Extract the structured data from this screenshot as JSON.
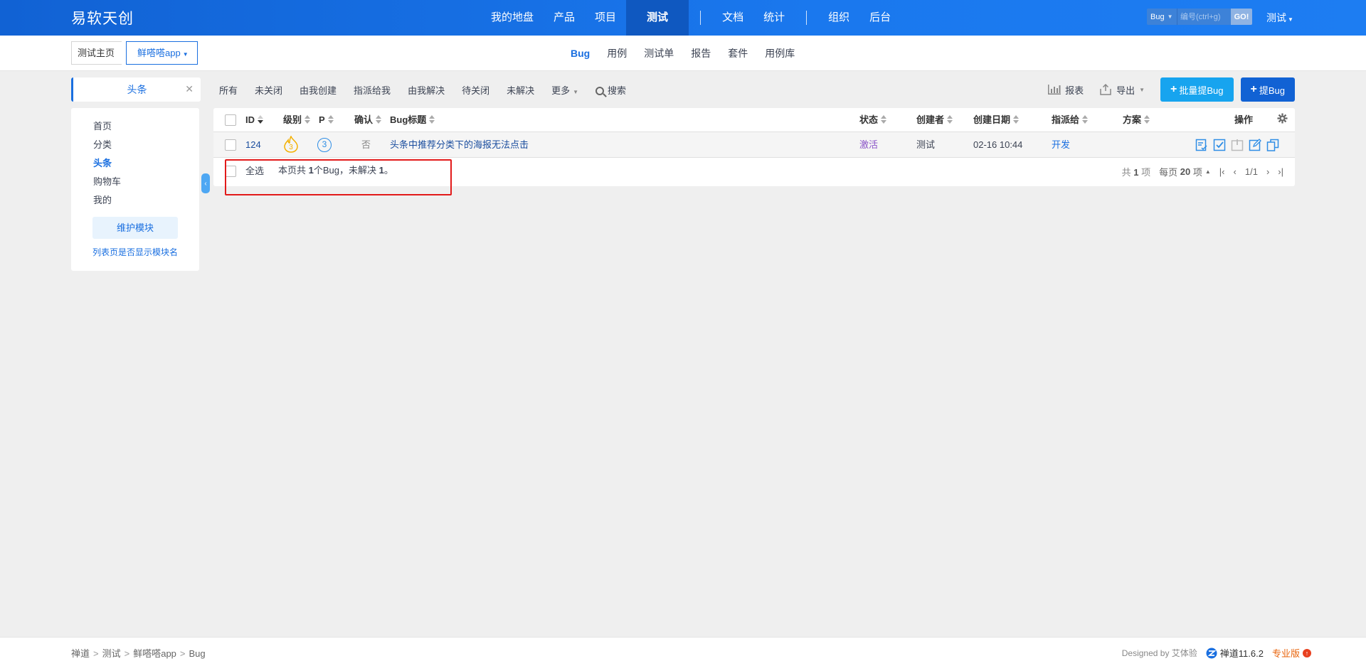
{
  "header": {
    "brand": "易软天创",
    "nav": [
      {
        "label": "我的地盘",
        "active": false
      },
      {
        "label": "产品",
        "active": false
      },
      {
        "label": "项目",
        "active": false
      },
      {
        "label": "测试",
        "active": true
      },
      {
        "label": "文档",
        "active": false
      },
      {
        "label": "统计",
        "active": false
      },
      {
        "label": "组织",
        "active": false
      },
      {
        "label": "后台",
        "active": false
      }
    ],
    "search": {
      "type": "Bug",
      "placeholder": "编号(ctrl+g)",
      "go": "GO!"
    },
    "user": "测试"
  },
  "subheader": {
    "home_crumb": "测试主页",
    "product_crumb": "鲜嗒嗒app",
    "tabs": [
      {
        "label": "Bug",
        "active": true
      },
      {
        "label": "用例",
        "active": false
      },
      {
        "label": "测试单",
        "active": false
      },
      {
        "label": "报告",
        "active": false
      },
      {
        "label": "套件",
        "active": false
      },
      {
        "label": "用例库",
        "active": false
      }
    ]
  },
  "featurebar": {
    "module_tab": "头条",
    "filters": [
      "所有",
      "未关闭",
      "由我创建",
      "指派给我",
      "由我解决",
      "待关闭",
      "未解决",
      "更多",
      "搜索"
    ],
    "report": "报表",
    "export": "导出",
    "batch_create": "批量提Bug",
    "create": "提Bug"
  },
  "sidebar": {
    "items": [
      {
        "label": "首页",
        "active": false
      },
      {
        "label": "分类",
        "active": false
      },
      {
        "label": "头条",
        "active": true
      },
      {
        "label": "购物车",
        "active": false
      },
      {
        "label": "我的",
        "active": false
      }
    ],
    "maintain_button": "维护模块",
    "show_module_link": "列表页是否显示模块名"
  },
  "table": {
    "headers": {
      "id": "ID",
      "severity": "级别",
      "pri": "P",
      "confirmed": "确认",
      "title": "Bug标题",
      "status": "状态",
      "creator": "创建者",
      "created_date": "创建日期",
      "assigned_to": "指派给",
      "resolution": "方案",
      "actions": "操作"
    },
    "rows": [
      {
        "id": "124",
        "severity": "3",
        "pri": "3",
        "confirmed": "否",
        "title": "头条中推荐分类下的海报无法点击",
        "status": "激活",
        "creator": "测试",
        "created_date": "02-16 10:44",
        "assigned_to": "开发",
        "resolution": ""
      }
    ],
    "footer": {
      "select_all": "全选",
      "summary_prefix": "本页共",
      "summary_count": "1",
      "summary_mid": "个Bug，未解决",
      "summary_unresolved": "1",
      "summary_end": "。",
      "total_prefix": "共",
      "total": "1",
      "total_suffix": "项",
      "per_page_prefix": "每页",
      "per_page": "20",
      "per_page_suffix": "项",
      "page": "1/1"
    }
  },
  "footer": {
    "crumbs": [
      "禅道",
      "测试",
      "鲜嗒嗒app",
      "Bug"
    ],
    "designed_by": "Designed by 艾体验",
    "version": "禅道11.6.2",
    "edition": "专业版"
  },
  "colors": {
    "primary": "#1162d4",
    "accent": "#17a4ef",
    "highlight_box": "#e21a1a",
    "status_active": "#8a53c7"
  }
}
